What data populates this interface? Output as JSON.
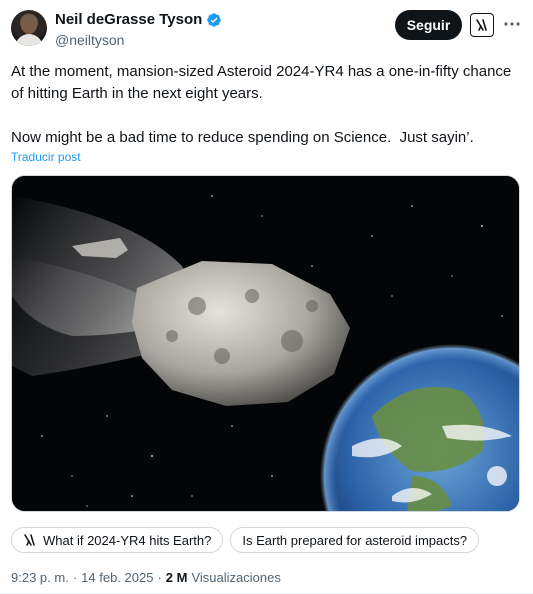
{
  "author": {
    "name": "Neil deGrasse Tyson",
    "handle": "@neiltyson",
    "verified_icon": "verified-badge-icon"
  },
  "actions": {
    "follow_label": "Seguir",
    "grok_icon": "grok-icon",
    "more_icon": "more-icon"
  },
  "tweet": {
    "text": "At the moment, mansion-sized Asteroid 2024-YR4 has a one-in-fifty chance of hitting Earth in the next eight years.\n\nNow might be a bad time to reduce spending on Science.  Just sayin’.",
    "translate_label": "Traducir post"
  },
  "suggestions": [
    {
      "label": "What if 2024-YR4 hits Earth?",
      "icon": "grok-icon"
    },
    {
      "label": "Is Earth prepared for asteroid impacts?"
    }
  ],
  "meta": {
    "time": "9:23 p. m.",
    "separator": "·",
    "date": "14 feb. 2025",
    "separator2": "·",
    "views_count": "2 M",
    "views_label": "Visualizaciones"
  },
  "colors": {
    "accent": "#1d9bf0",
    "text": "#0f1419",
    "muted": "#536471"
  }
}
